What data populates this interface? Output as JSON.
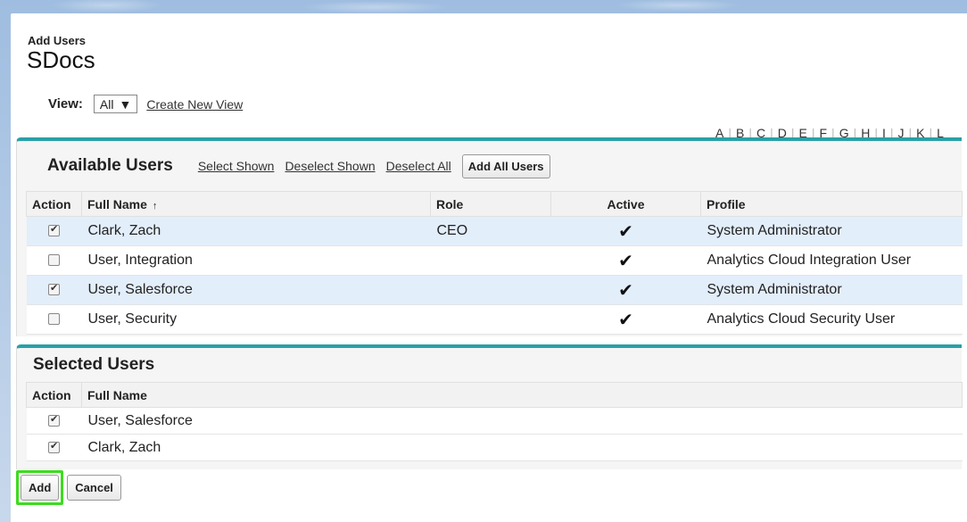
{
  "header": {
    "breadcrumb": "Add Users",
    "title": "SDocs"
  },
  "view": {
    "label": "View:",
    "selected": "All",
    "create_link": "Create New View"
  },
  "alphabet": [
    "A",
    "B",
    "C",
    "D",
    "E",
    "F",
    "G",
    "H",
    "I",
    "J",
    "K",
    "L"
  ],
  "available": {
    "title": "Available Users",
    "links": [
      "Select Shown",
      "Deselect Shown",
      "Deselect All"
    ],
    "add_all_button": "Add All Users",
    "columns": [
      "Action",
      "Full Name",
      "Role",
      "Active",
      "Profile"
    ],
    "rows": [
      {
        "checked": true,
        "name": "Clark, Zach",
        "role": "CEO",
        "active": "✔",
        "profile": "System Administrator"
      },
      {
        "checked": false,
        "name": "User, Integration",
        "role": "",
        "active": "✔",
        "profile": "Analytics Cloud Integration User"
      },
      {
        "checked": true,
        "name": "User, Salesforce",
        "role": "",
        "active": "✔",
        "profile": "System Administrator"
      },
      {
        "checked": false,
        "name": "User, Security",
        "role": "",
        "active": "✔",
        "profile": "Analytics Cloud Security User"
      }
    ]
  },
  "selected": {
    "title": "Selected Users",
    "columns": [
      "Action",
      "Full Name"
    ],
    "rows": [
      {
        "checked": true,
        "name": "User, Salesforce"
      },
      {
        "checked": true,
        "name": "Clark, Zach"
      }
    ]
  },
  "footer": {
    "add_label": "Add",
    "cancel_label": "Cancel"
  },
  "colors": {
    "accent": "#2aa0a8",
    "highlight_row": "#e3eefb",
    "focus_outline": "#3ddc1f"
  }
}
